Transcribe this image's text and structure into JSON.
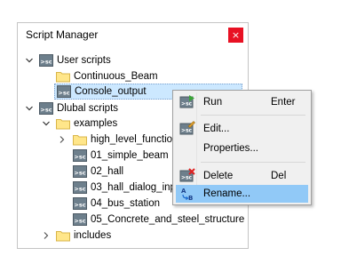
{
  "panel": {
    "title": "Script Manager",
    "close_label": "×"
  },
  "tree": {
    "user_scripts": "User scripts",
    "continuous_beam": "Continuous_Beam",
    "console_output": "Console_output",
    "dlubal_scripts": "Dlubal scripts",
    "examples": "examples",
    "high_level": "high_level_functions",
    "simple_beam": "01_simple_beam",
    "hall": "02_hall",
    "hall_dialog": "03_hall_dialog_input",
    "bus_station": "04_bus_station",
    "concrete_steel": "05_Concrete_and_steel_structure",
    "includes": "includes"
  },
  "context_menu": {
    "run": "Run",
    "run_shortcut": "Enter",
    "edit": "Edit...",
    "properties": "Properties...",
    "delete": "Delete",
    "delete_shortcut": "Del",
    "rename": "Rename..."
  },
  "colors": {
    "close_bg": "#e81123",
    "selection_bg": "#cce8ff",
    "menu_hover": "#91c9f7",
    "folder_fill": "#ffe68a",
    "folder_stroke": "#d9b64a",
    "script_icon_bg": "#6d7f8c"
  },
  "icons": {
    "script": "script-file-icon",
    "folder": "folder-icon",
    "run": "run-script-icon",
    "edit": "edit-script-icon",
    "delete": "delete-script-icon",
    "rename": "rename-icon"
  }
}
